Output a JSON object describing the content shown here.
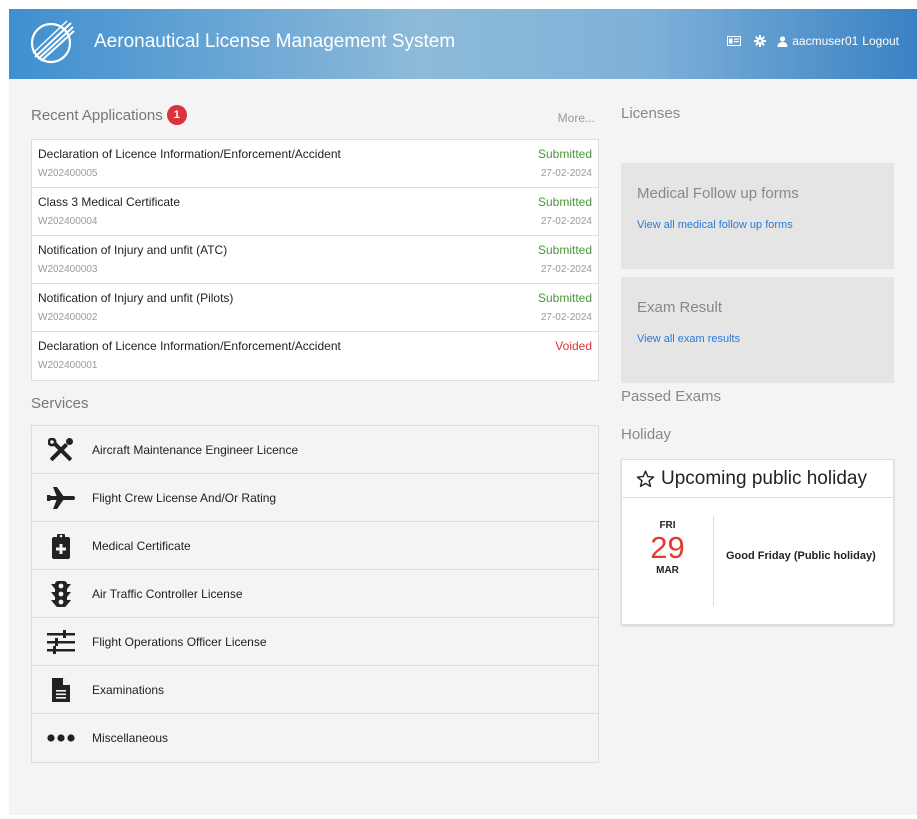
{
  "header": {
    "app_title": "Aeronautical License Management System",
    "username": "aacmuser01",
    "logout_label": "Logout",
    "icons": [
      "id-card-icon",
      "gear-icon",
      "user-icon"
    ]
  },
  "recent": {
    "title": "Recent Applications",
    "badge_count": "1",
    "more_label": "More...",
    "items": [
      {
        "name": "Declaration of Licence Information/Enforcement/Accident",
        "code": "W202400005",
        "status": "Submitted",
        "date": "27-02-2024"
      },
      {
        "name": "Class 3 Medical Certificate",
        "code": "W202400004",
        "status": "Submitted",
        "date": "27-02-2024"
      },
      {
        "name": "Notification of Injury and unfit (ATC)",
        "code": "W202400003",
        "status": "Submitted",
        "date": "27-02-2024"
      },
      {
        "name": "Notification of Injury and unfit (Pilots)",
        "code": "W202400002",
        "status": "Submitted",
        "date": "27-02-2024"
      },
      {
        "name": "Declaration of Licence Information/Enforcement/Accident",
        "code": "W202400001",
        "status": "Voided",
        "date": ""
      }
    ]
  },
  "services": {
    "title": "Services",
    "items": [
      {
        "label": "Aircraft Maintenance Engineer Licence",
        "icon": "tools-icon"
      },
      {
        "label": "Flight Crew License And/Or Rating",
        "icon": "plane-icon"
      },
      {
        "label": "Medical Certificate",
        "icon": "medical-clipboard-icon"
      },
      {
        "label": "Air Traffic Controller License",
        "icon": "traffic-light-icon"
      },
      {
        "label": "Flight Operations Officer License",
        "icon": "sliders-icon"
      },
      {
        "label": "Examinations",
        "icon": "document-icon"
      },
      {
        "label": "Miscellaneous",
        "icon": "ellipsis-icon"
      }
    ]
  },
  "right": {
    "licenses_title": "Licenses",
    "medical_panel": {
      "title": "Medical Follow up forms",
      "link": "View all medical follow up forms"
    },
    "exam_panel": {
      "title": "Exam Result",
      "link": "View all exam results"
    },
    "passed_title": "Passed Exams",
    "holiday_title": "Holiday",
    "holiday_card": {
      "header": "Upcoming public holiday",
      "dow": "FRI",
      "day": "29",
      "month": "MAR",
      "name": "Good Friday (Public holiday)"
    }
  },
  "colors": {
    "submitted": "#4a9a3c",
    "voided": "#d9343b",
    "badge": "#d9343b",
    "link": "#2a7bd6",
    "holiday_day": "#e33a2f"
  }
}
